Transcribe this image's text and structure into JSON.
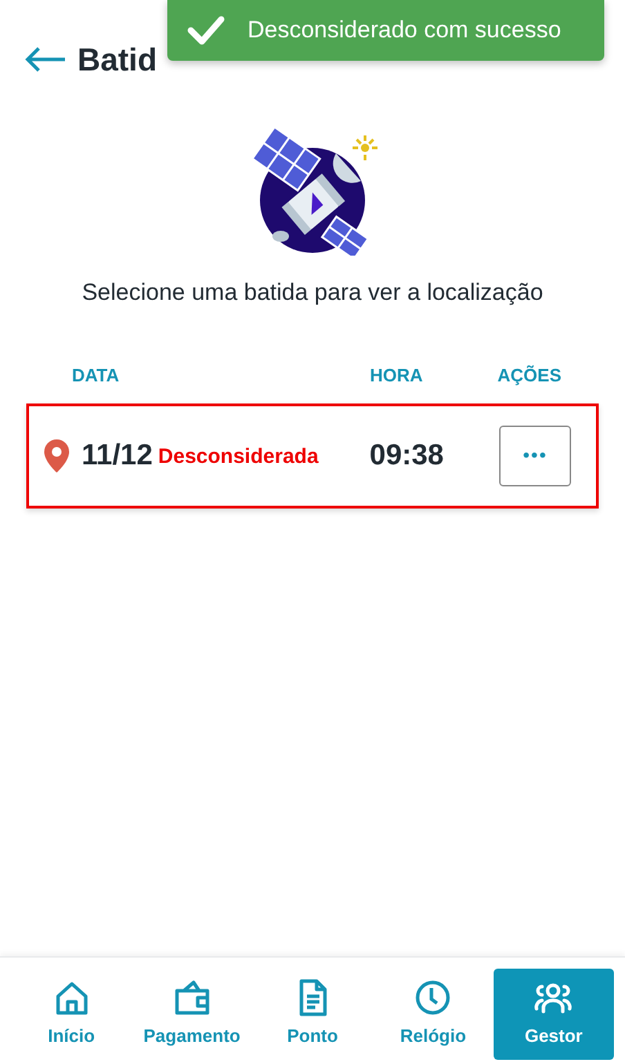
{
  "header": {
    "title": "Batid"
  },
  "toast": {
    "message": "Desconsiderado com sucesso"
  },
  "prompt": "Selecione uma batida para ver a localização",
  "table": {
    "columns": [
      "DATA",
      "HORA",
      "AÇÕES"
    ],
    "rows": [
      {
        "date": "11/12",
        "status": "Desconsiderada",
        "time": "09:38",
        "actions": "•••",
        "selected": true
      }
    ]
  },
  "nav": [
    {
      "label": "Início",
      "kind": "home",
      "selected": false
    },
    {
      "label": "Pagamento",
      "kind": "wallet",
      "selected": false
    },
    {
      "label": "Ponto",
      "kind": "document",
      "selected": false
    },
    {
      "label": "Relógio",
      "kind": "clock",
      "selected": false
    },
    {
      "label": "Gestor",
      "kind": "people",
      "selected": true
    }
  ]
}
